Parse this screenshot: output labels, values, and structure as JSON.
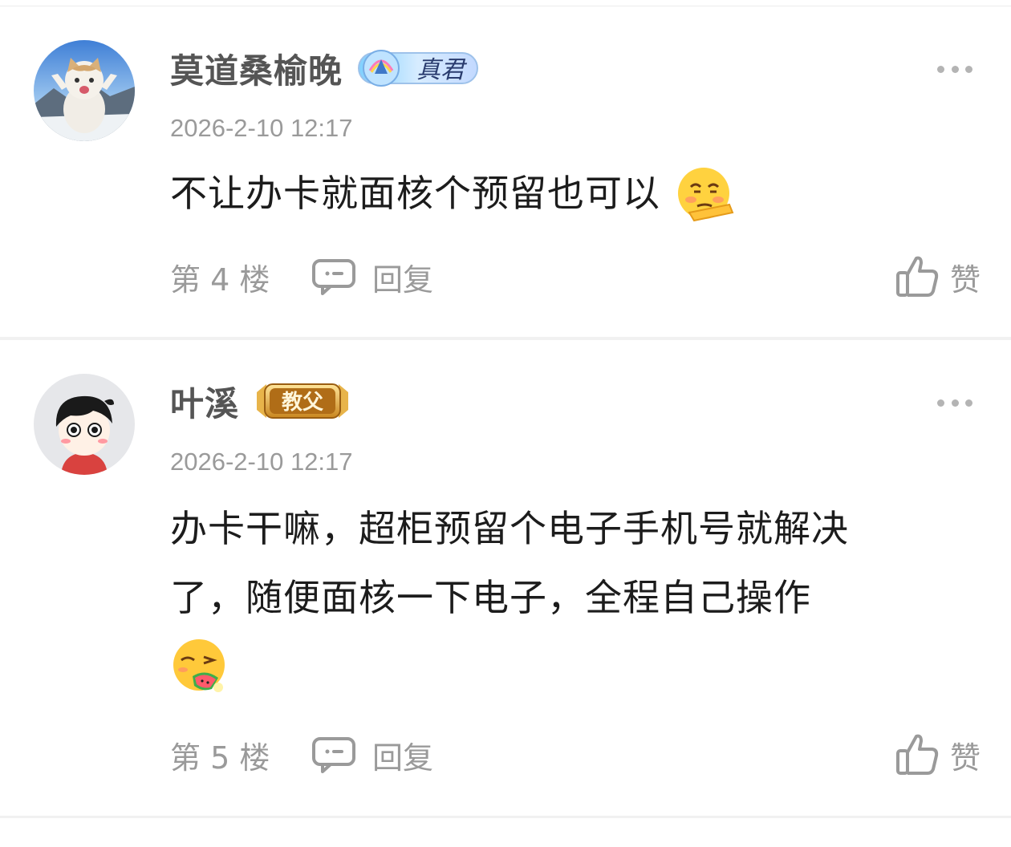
{
  "comments": [
    {
      "username": "莫道桑榆晚",
      "badge_text": "真君",
      "timestamp": "2026-2-10 12:17",
      "content": "不让办卡就面核个预留也可以",
      "floor": "第 4 楼",
      "reply_label": "回复",
      "like_label": "赞",
      "emoji": "smirk-hand-emoji"
    },
    {
      "username": "叶溪",
      "badge_text": "教父",
      "timestamp": "2026-2-10 12:17",
      "content_line1": "办卡干嘛，超柜预留个电子手机号就解决",
      "content_line2": "了，随便面核一下电子，全程自己操作",
      "floor": "第 5 楼",
      "reply_label": "回复",
      "like_label": "赞",
      "emoji": "eating-watermelon-emoji"
    }
  ],
  "colors": {
    "username": "#555555",
    "meta": "#9a9a9a",
    "content": "#1c1c1c",
    "separator": "#f1f1f1",
    "badge_gold": "#d9a63c"
  }
}
